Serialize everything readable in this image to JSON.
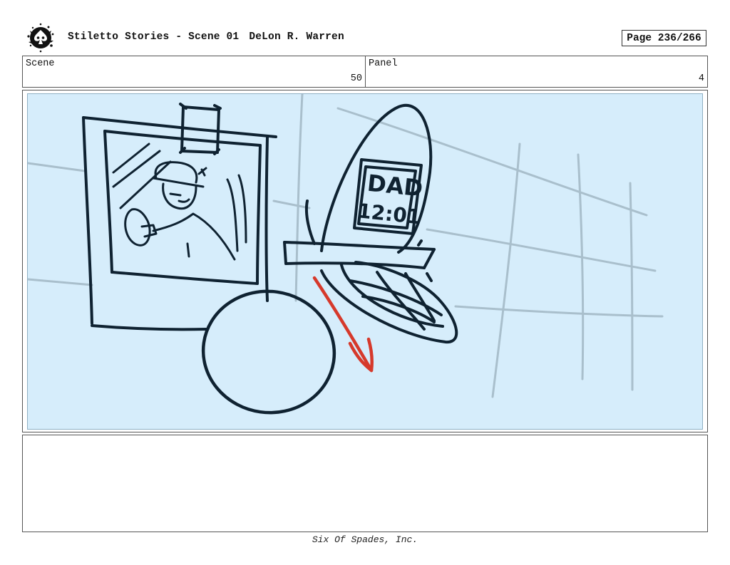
{
  "header": {
    "title": "Stiletto Stories - Scene 01",
    "author": "DeLon R. Warren",
    "page": "Page 236/266",
    "logo_icon": "spade-skull-logo"
  },
  "info": {
    "scene_label": "Scene",
    "scene_value": "50",
    "panel_label": "Panel",
    "panel_value": "4"
  },
  "frame": {
    "background_color": "#d6edfb",
    "ink_color": "#0f2231",
    "arrow_color": "#d6392b",
    "phone_screen_line1": "DAD",
    "phone_screen_line2": "12:01"
  },
  "notes": {
    "text": ""
  },
  "footer": {
    "text": "Six Of Spades, Inc."
  }
}
